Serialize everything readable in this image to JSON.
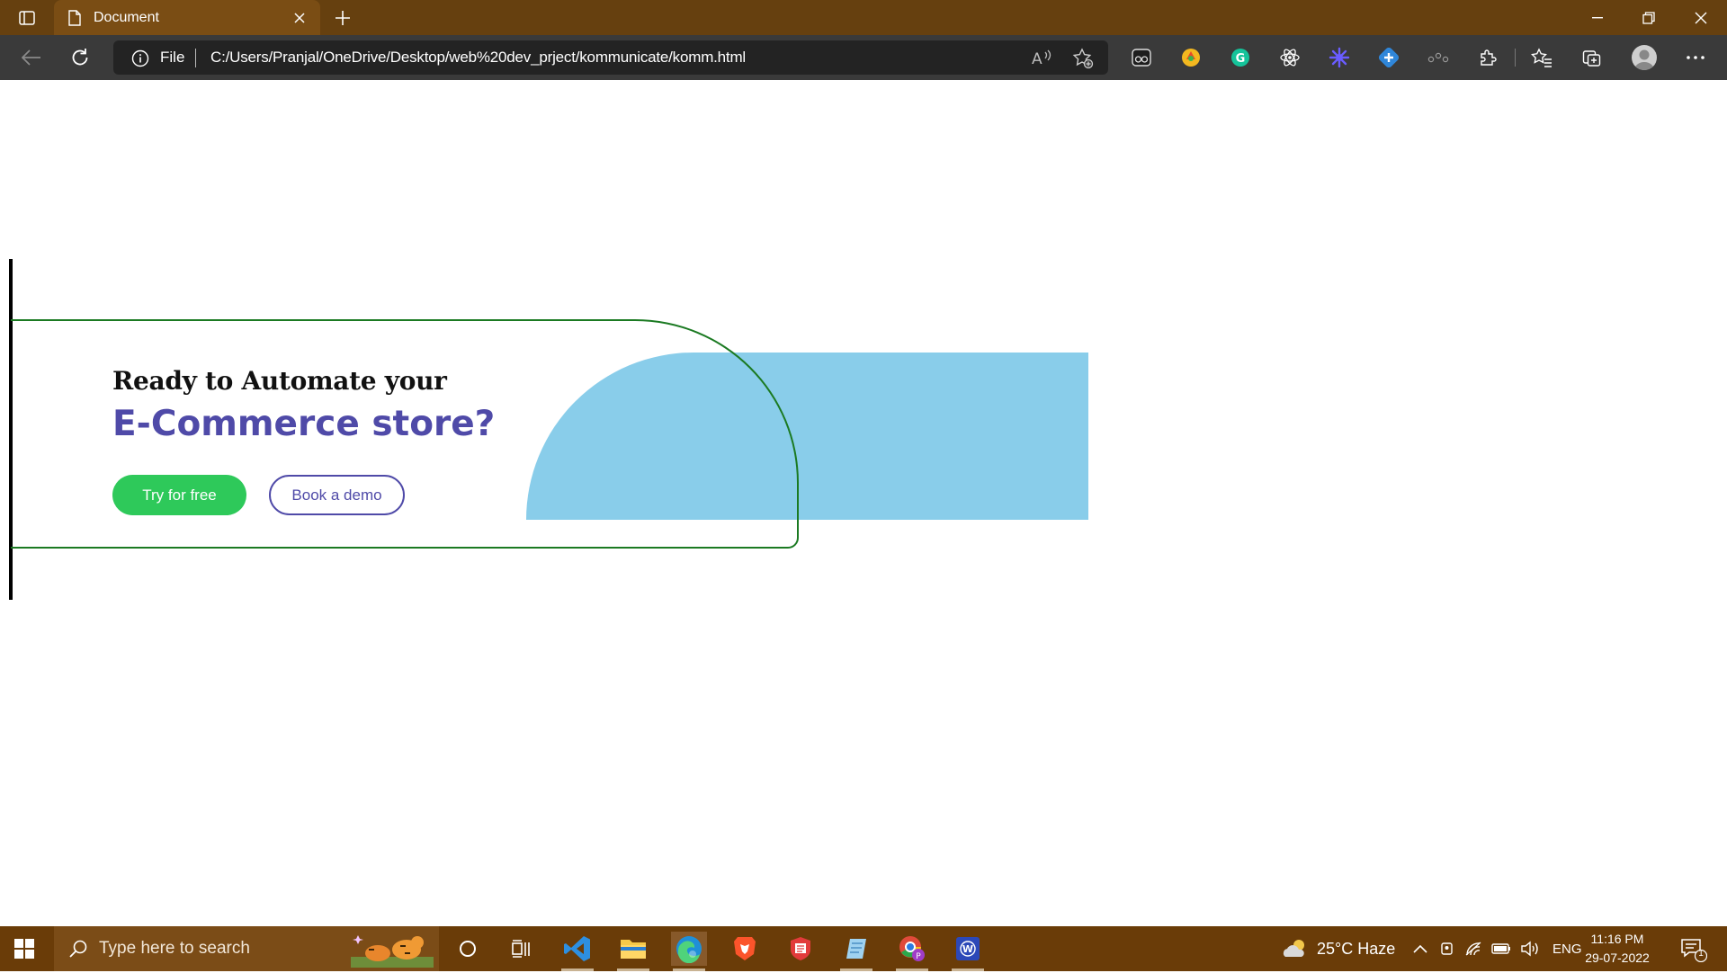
{
  "browser": {
    "tab_title": "Document",
    "address_scheme_label": "File",
    "url": "C:/Users/Pranjal/OneDrive/Desktop/web%20dev_prject/kommunicate/komm.html",
    "extensions": [
      "extension-1",
      "extension-2",
      "grammarly",
      "react-devtools",
      "extension-5",
      "extension-6",
      "extension-7"
    ]
  },
  "page": {
    "heading_line1": "Ready to Automate your",
    "heading_line2": "E-Commerce store?",
    "try_button": "Try for free",
    "demo_button": "Book a demo",
    "colors": {
      "heading2": "#4f4aa8",
      "try_button": "#2ec95a",
      "card_border": "#1b7a22",
      "blue_shape": "#89cdea"
    }
  },
  "taskbar": {
    "search_placeholder": "Type here to search",
    "weather": "25°C  Haze",
    "language": "ENG",
    "time": "11:16 PM",
    "date": "29-07-2022",
    "notification_count": "1"
  }
}
